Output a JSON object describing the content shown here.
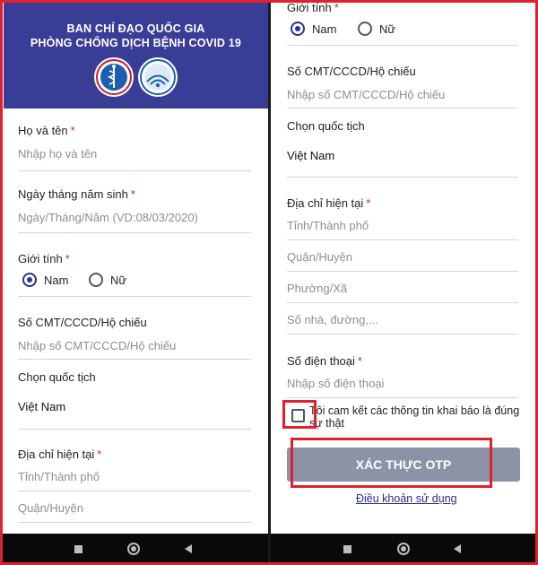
{
  "colors": {
    "banner_bg": "#3a3d96",
    "accent": "#2e318f",
    "required_marker": "#e0202a",
    "highlight": "#e0202a",
    "otp_button_bg": "#8d93a6",
    "nav_bar_bg": "#0a0a0a"
  },
  "header": {
    "title_line1": "BAN CHỈ ĐẠO QUỐC GIA",
    "title_line2": "PHÒNG CHỐNG DỊCH BỆNH COVID 19",
    "logos": [
      "ministry-of-health-logo",
      "ministry-of-information-logo"
    ]
  },
  "required_marker": "*",
  "form": {
    "full_name": {
      "label": "Họ và tên",
      "placeholder": "Nhập họ và tên"
    },
    "birth_date": {
      "label": "Ngày tháng năm sinh",
      "placeholder": "Ngày/Tháng/Năm (VD:08/03/2020)"
    },
    "gender": {
      "label": "Giới tính",
      "options": [
        "Nam",
        "Nữ"
      ],
      "selected": "Nam"
    },
    "id_number": {
      "label": "Số CMT/CCCD/Hộ chiếu",
      "placeholder": "Nhập số CMT/CCCD/Hộ chiếu"
    },
    "nationality": {
      "label": "Chọn quốc tịch",
      "value": "Việt Nam"
    },
    "address": {
      "label": "Địa chỉ hiện tại",
      "province_placeholder": "Tỉnh/Thành phố",
      "district_placeholder": "Quận/Huyện",
      "ward_placeholder": "Phường/Xã",
      "street_placeholder": "Số nhà, đường,..."
    },
    "phone": {
      "label": "Số điện thoại",
      "placeholder": "Nhập số điện thoại"
    },
    "consent": {
      "line1": "Tôi cam kết các thông tin khai báo là đúng",
      "line2": "sự thật",
      "checked": false
    },
    "submit_label": "XÁC THỰC OTP",
    "terms_link": "Điều khoản sử dụng"
  },
  "nav_bar": {
    "buttons": [
      "recent-apps-icon",
      "home-icon",
      "back-icon"
    ]
  }
}
